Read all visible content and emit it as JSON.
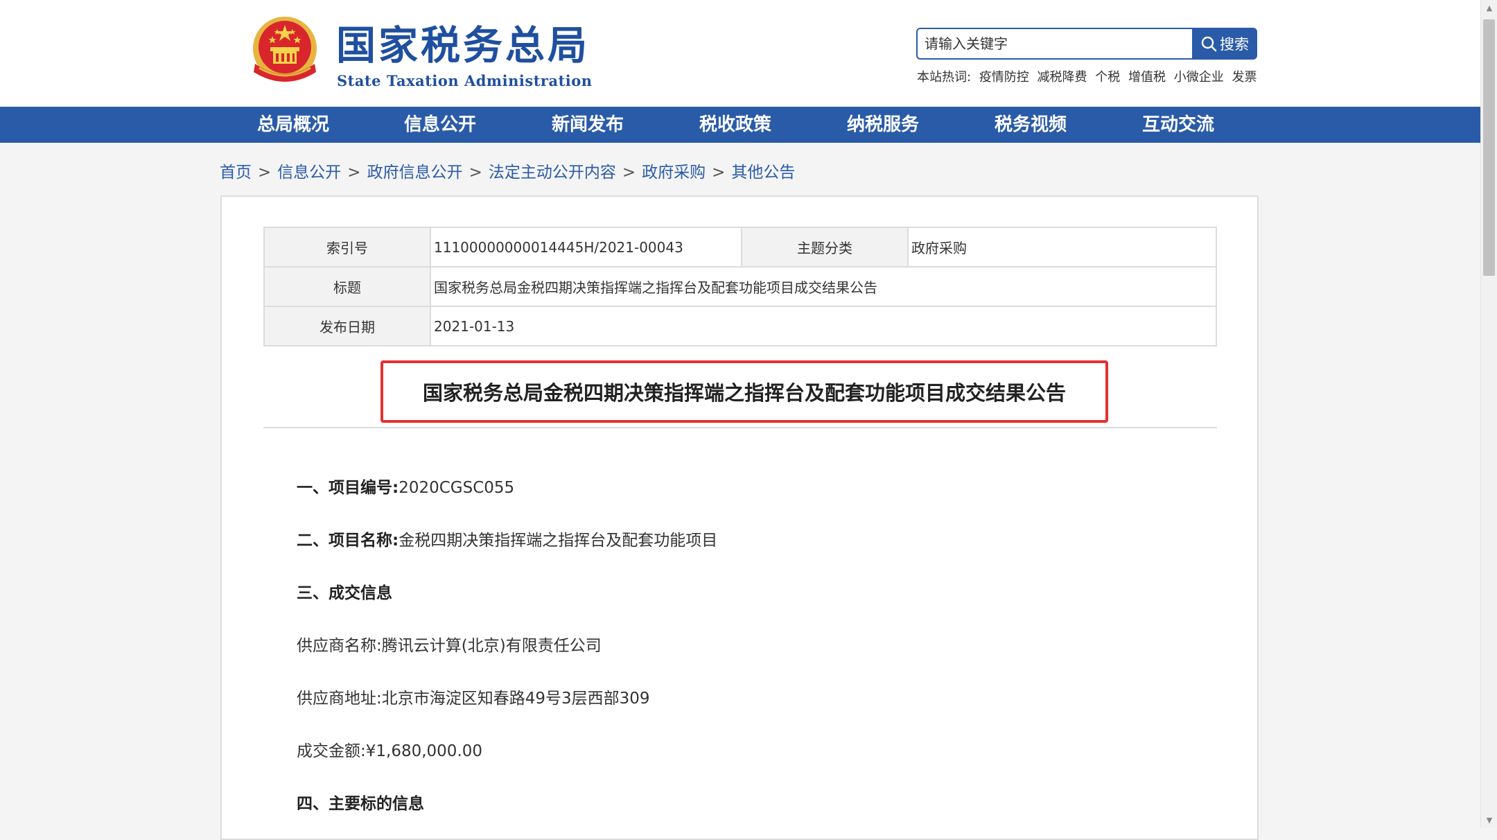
{
  "header": {
    "logo_cn": "国家税务总局",
    "logo_en": "State Taxation Administration",
    "search": {
      "placeholder": "请输入关键字",
      "button_label": "搜索"
    },
    "hot_words": {
      "label": "本站热词:",
      "items": [
        "疫情防控",
        "减税降费",
        "个税",
        "增值税",
        "小微企业",
        "发票"
      ]
    }
  },
  "nav": {
    "items": [
      "总局概况",
      "信息公开",
      "新闻发布",
      "税收政策",
      "纳税服务",
      "税务视频",
      "互动交流"
    ]
  },
  "breadcrumb": [
    "首页",
    "信息公开",
    "政府信息公开",
    "法定主动公开内容",
    "政府采购",
    "其他公告"
  ],
  "breadcrumb_sep": ">",
  "meta": {
    "index_label": "索引号",
    "index_value": "11100000000014445H/2021-00043",
    "topic_label": "主题分类",
    "topic_value": "政府采购",
    "title_label": "标题",
    "title_value": "国家税务总局金税四期决策指挥端之指挥台及配套功能项目成交结果公告",
    "date_label": "发布日期",
    "date_value": "2021-01-13"
  },
  "article": {
    "title": "国家税务总局金税四期决策指挥端之指挥台及配套功能项目成交结果公告",
    "p1_label": "一、项目编号:",
    "p1_value": "2020CGSC055",
    "p2_label": "二、项目名称:",
    "p2_value": "金税四期决策指挥端之指挥台及配套功能项目",
    "p3_label": "三、成交信息",
    "p4": "供应商名称:腾讯云计算(北京)有限责任公司",
    "p5": "供应商地址:北京市海淀区知春路49号3层西部309",
    "p6": "成交金额:¥1,680,000.00",
    "p7_label": "四、主要标的信息"
  },
  "colors": {
    "brand_blue": "#2a5ba8",
    "highlight_red": "#e53030"
  }
}
